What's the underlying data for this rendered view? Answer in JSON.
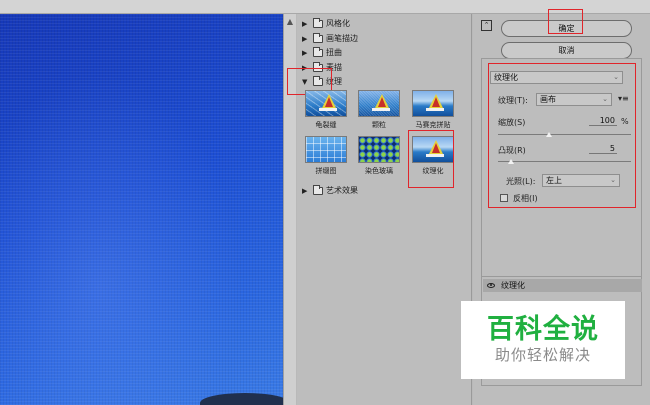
{
  "gallery": {
    "categories": {
      "stylize": "风格化",
      "brush_strokes": "画笔描边",
      "distort": "扭曲",
      "sketch": "素描",
      "texture": "纹理",
      "artistic": "艺术效果"
    },
    "texture_filters": [
      "龟裂缝",
      "颗粒",
      "马赛克拼贴",
      "拼缀图",
      "染色玻璃",
      "纹理化"
    ],
    "selected_filter": "纹理化"
  },
  "buttons": {
    "ok": "确定",
    "cancel": "取消"
  },
  "settings": {
    "filter_select": "纹理化",
    "texture_label": "纹理(T):",
    "texture_value": "画布",
    "scaling_label": "缩放(S)",
    "scaling_value": "100",
    "scaling_unit": "%",
    "scaling_fraction": 0.38,
    "relief_label": "凸现(R)",
    "relief_value": "5",
    "relief_fraction": 0.1,
    "light_label": "光照(L):",
    "light_value": "左上",
    "invert_label": "反相(I)",
    "invert_checked": false
  },
  "layers": {
    "active": "纹理化"
  },
  "watermark": {
    "brand": "百科全说",
    "slogan": "助你轻松解决"
  },
  "colors": {
    "highlight": "#e0252b",
    "watermark_green": "#20b040"
  }
}
